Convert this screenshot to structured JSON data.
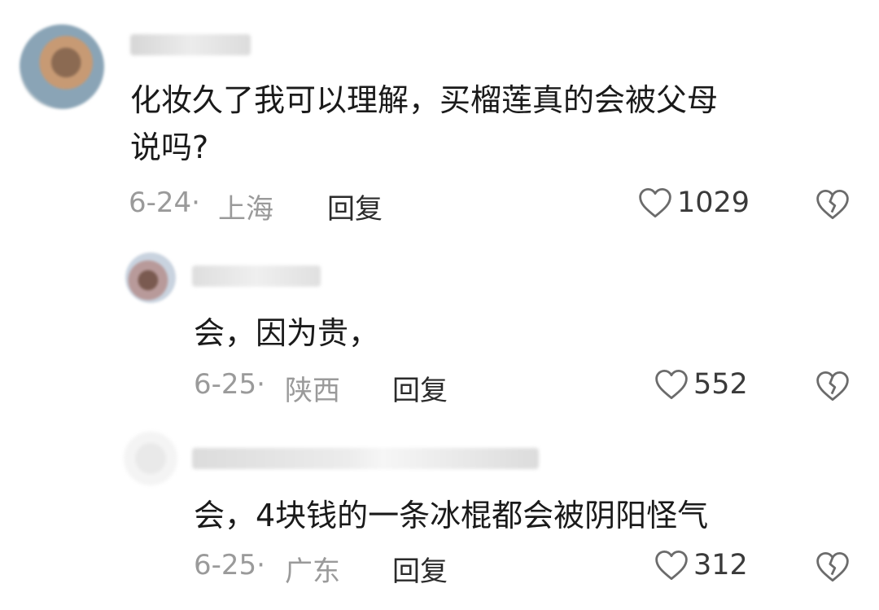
{
  "comments": [
    {
      "username": "",
      "text_line1": "化妆久了我可以理解，买榴莲真的会被父母",
      "text_line2": "说吗?",
      "date": "6-24·",
      "location": "上海",
      "reply_label": "回复",
      "likes": "1029"
    },
    {
      "username": "",
      "text_line1": "会，因为贵，",
      "date": "6-25·",
      "location": "陕西",
      "reply_label": "回复",
      "likes": "552"
    },
    {
      "username": "",
      "text_line1": "会，4块钱的一条冰棍都会被阴阳怪气",
      "date": "6-25·",
      "location": "广东",
      "reply_label": "回复",
      "likes": "312"
    }
  ],
  "colors": {
    "meta": "#9a9a9a",
    "text": "#1a1a1a",
    "icon": "#6b6b6b"
  },
  "icons": [
    "heart-outline-icon",
    "broken-heart-icon"
  ]
}
